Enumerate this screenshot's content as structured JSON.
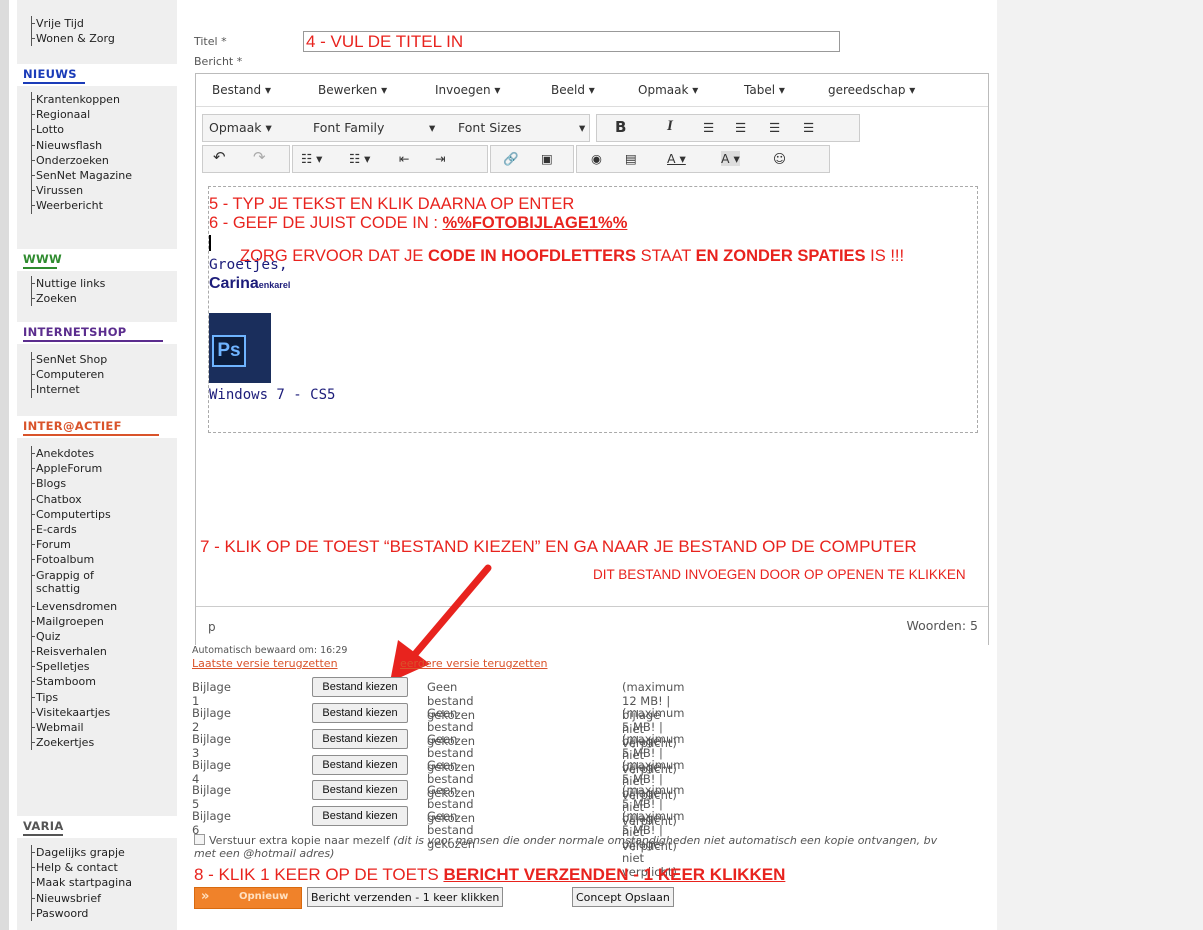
{
  "sidebar": {
    "top_items": [
      "Vrije Tijd",
      "Wonen & Zorg"
    ],
    "sections": [
      {
        "title": "NIEUWS",
        "color": "#1a3bb8",
        "items": [
          "Krantenkoppen",
          "Regionaal",
          "Lotto",
          "Nieuwsflash",
          "Onderzoeken",
          "SenNet Magazine",
          "Virussen",
          "Weerbericht"
        ]
      },
      {
        "title": "WWW",
        "color": "#2e8b2e",
        "items": [
          "Nuttige links",
          "Zoeken"
        ]
      },
      {
        "title": "INTERNETSHOP",
        "color": "#5b2d8e",
        "items": [
          "SenNet Shop",
          "Computeren",
          "Internet"
        ]
      },
      {
        "title": "INTER@ACTIEF",
        "color": "#d9532a",
        "items": [
          "Anekdotes",
          "AppleForum",
          "Blogs",
          "Chatbox",
          "Computertips",
          "E-cards",
          "Forum",
          "Fotoalbum",
          "Grappig of schattig",
          "Levensdromen",
          "Mailgroepen",
          "Quiz",
          "Reisverhalen",
          "Spelletjes",
          "Stamboom",
          "Tips",
          "Visitekaartjes",
          "Webmail",
          "Zoekertjes"
        ]
      },
      {
        "title": "VARIA",
        "color": "#555555",
        "items": [
          "Dagelijks grapje",
          "Help & contact",
          "Maak startpagina",
          "Nieuwsbrief",
          "Paswoord"
        ]
      }
    ]
  },
  "form": {
    "title_label": "Titel *",
    "title_value": "4 - VUL DE TITEL IN",
    "message_label": "Bericht *"
  },
  "editor": {
    "menu": [
      "Bestand",
      "Bewerken",
      "Invoegen",
      "Beeld",
      "Opmaak",
      "Tabel",
      "gereedschap"
    ],
    "format_select": "Opmaak",
    "font_family": "Font Family",
    "font_sizes": "Font Sizes",
    "bold": "B",
    "italic": "I",
    "content": {
      "line1": "5 - TYP JE TEKST EN KLIK DAARNA OP ENTER",
      "line2_prefix": "6 - GEEF DE JUIST CODE IN : ",
      "line2_code": "%%FOTOBIJLAGE1%%",
      "warning_a": "ZORG ERVOOR DAT JE ",
      "warning_b": "CODE IN HOOFDLETTERS",
      "warning_c": " STAAT ",
      "warning_d": "EN ZONDER SPATIES",
      "warning_e": " IS !!!",
      "greeting": "Groetjes,",
      "signature": "Carina",
      "signature_small": "enkarel",
      "logo_text": "Ps",
      "caption": "Windows 7 - CS5"
    },
    "status_path": "p",
    "word_count": "Woorden: 5"
  },
  "annotations": {
    "step7": "7 - KLIK OP DE TOEST “BESTAND KIEZEN” EN GA NAAR JE BESTAND OP DE COMPUTER",
    "step7b": "DIT BESTAND INVOEGEN DOOR OP OPENEN TE KLIKKEN",
    "step8_prefix": "8 - KLIK 1 KEER OP DE TOETS ",
    "step8_link": "BERICHT VERZENDEN - 1 KEER KLIKKEN"
  },
  "autosave": {
    "text": "Automatisch bewaard om: 16:29",
    "restore_last": "Laatste versie terugzetten",
    "restore_older": "eerdere versie terugzetten"
  },
  "attachments": [
    {
      "label": "Bijlage 1",
      "button": "Bestand kiezen",
      "status": "Geen bestand gekozen",
      "note": "(maximum 12 MB! | bijlage niet verplicht)"
    },
    {
      "label": "Bijlage 2",
      "button": "Bestand kiezen",
      "status": "Geen bestand gekozen",
      "note": "(maximum 5 MB! | bijlage niet verplicht)"
    },
    {
      "label": "Bijlage 3",
      "button": "Bestand kiezen",
      "status": "Geen bestand gekozen",
      "note": "(maximum 5 MB! | bijlage niet verplicht)"
    },
    {
      "label": "Bijlage 4",
      "button": "Bestand kiezen",
      "status": "Geen bestand gekozen",
      "note": "(maximum 5 MB! | bijlage niet verplicht)"
    },
    {
      "label": "Bijlage 5",
      "button": "Bestand kiezen",
      "status": "Geen bestand gekozen",
      "note": "(maximum 5 MB! | bijlage niet verplicht)"
    },
    {
      "label": "Bijlage 6",
      "button": "Bestand kiezen",
      "status": "Geen bestand gekozen",
      "note": "(maximum 5 MB! | bijlage niet verplicht)"
    }
  ],
  "copy_option": {
    "label": "Verstuur extra kopie naar mezelf",
    "note": "(dit is voor mensen die onder normale omstandigheden niet automatisch een kopie ontvangen, bv met een @hotmail adres)"
  },
  "buttons": {
    "reset": "Opnieuw",
    "send": "Bericht verzenden - 1 keer klikken",
    "draft": "Concept Opslaan"
  },
  "colors": {
    "annotation_red": "#e8231e",
    "reset_orange": "#f0822a"
  }
}
